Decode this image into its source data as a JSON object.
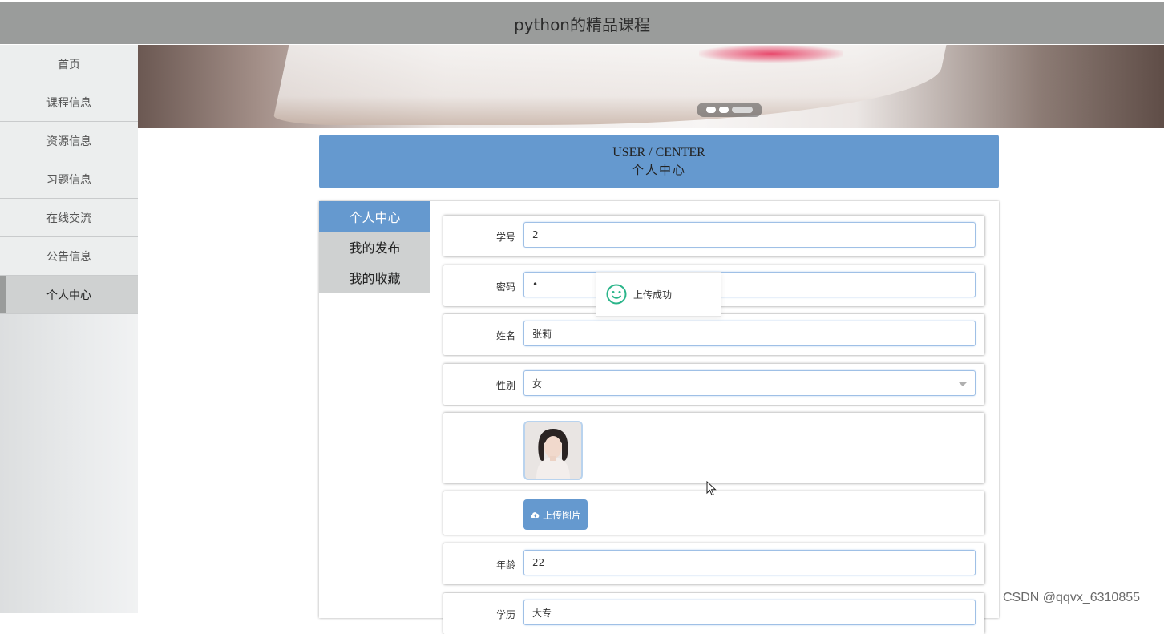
{
  "header": {
    "title": "python的精品课程"
  },
  "sidebar": {
    "items": [
      {
        "label": "首页"
      },
      {
        "label": "课程信息"
      },
      {
        "label": "资源信息"
      },
      {
        "label": "习题信息"
      },
      {
        "label": "在线交流"
      },
      {
        "label": "公告信息"
      },
      {
        "label": "个人中心",
        "active": true
      }
    ]
  },
  "banner": {
    "slide_count": 3,
    "active_slide": 3
  },
  "center": {
    "title_en": "USER / CENTER",
    "title_zh": "个人中心"
  },
  "subnav": {
    "items": [
      {
        "label": "个人中心",
        "active": true
      },
      {
        "label": "我的发布"
      },
      {
        "label": "我的收藏"
      }
    ]
  },
  "form": {
    "student_id": {
      "label": "学号",
      "value": "2"
    },
    "password": {
      "label": "密码",
      "value": "•"
    },
    "name": {
      "label": "姓名",
      "value": "张莉"
    },
    "gender": {
      "label": "性别",
      "value": "女"
    },
    "upload_button": {
      "label": "上传图片",
      "icon": "cloud-upload-icon"
    },
    "age": {
      "label": "年龄",
      "value": "22"
    },
    "education": {
      "label": "学历",
      "value": "大专"
    }
  },
  "toast": {
    "message": "上传成功",
    "icon": "smile-icon"
  },
  "watermark": "CSDN @qqvx_6310855",
  "colors": {
    "accent": "#6599cf",
    "topbar": "#9a9c9b",
    "toast_icon": "#2bb58a"
  }
}
